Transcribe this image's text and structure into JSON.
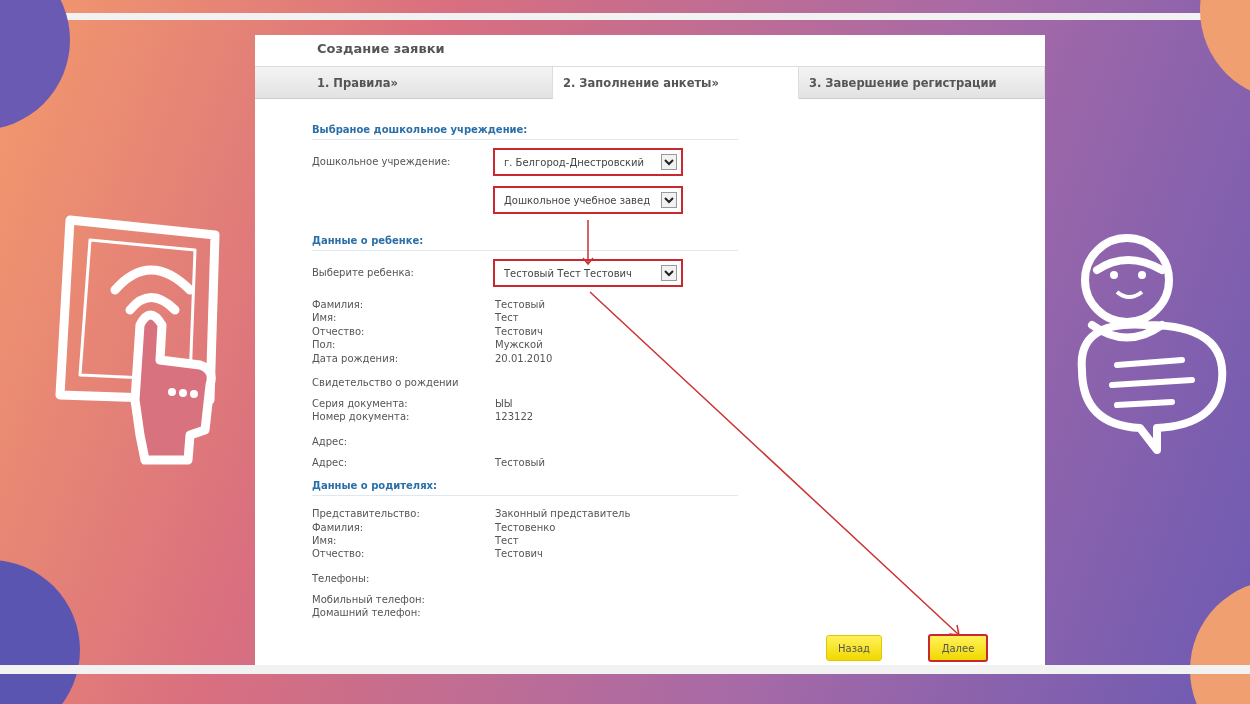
{
  "title": "Создание заявки",
  "tabs": [
    {
      "label": "1. Правила»",
      "selected": false
    },
    {
      "label": "2. Заполнение анкеты»",
      "selected": true
    },
    {
      "label": "3. Завершение регистрации",
      "selected": false
    }
  ],
  "institution": {
    "heading": "Выбраное дошкольное учреждение:",
    "label": "Дошкольное учреждение:",
    "selects": [
      {
        "value": "г. Белгород-Днестровский",
        "highlighted": true
      },
      {
        "value": "Дошкольное учебное завед",
        "highlighted": true
      }
    ]
  },
  "child": {
    "heading": "Данные о ребенке:",
    "select_label": "Выберите ребенка:",
    "select": {
      "value": "Тестовый Тест Тестович",
      "highlighted": true
    },
    "groups": [
      {
        "rows": [
          {
            "label": "Фамилия:",
            "value": "Тестовый"
          },
          {
            "label": "Имя:",
            "value": "Тест"
          },
          {
            "label": "Отчество:",
            "value": "Тестович"
          },
          {
            "label": "Пол:",
            "value": "Мужской"
          },
          {
            "label": "Дата рождения:",
            "value": "20.01.2010"
          }
        ]
      },
      {
        "title": "Свидетельство о рождении",
        "rows": [
          {
            "label": "Серия документа:",
            "value": "ЫЫ"
          },
          {
            "label": "Номер документа:",
            "value": "123122"
          }
        ]
      },
      {
        "title": "Адрес:",
        "rows": [
          {
            "label": "Адрес:",
            "value": "Тестовый"
          }
        ]
      }
    ]
  },
  "parents": {
    "heading": "Данные о родителях:",
    "groups": [
      {
        "rows": [
          {
            "label": "Представительство:",
            "value": "Законный представитель"
          },
          {
            "label": "Фамилия:",
            "value": "Тестовенко"
          },
          {
            "label": "Имя:",
            "value": "Тест"
          },
          {
            "label": "Отчество:",
            "value": "Тестович"
          }
        ]
      },
      {
        "title": "Телефоны:",
        "rows": [
          {
            "label": "Мобильный телефон:"
          },
          {
            "label": "Домашний телефон:"
          }
        ]
      }
    ]
  },
  "buttons": [
    {
      "label": "Назад",
      "highlighted": false
    },
    {
      "label": "Далее",
      "highlighted": true
    }
  ]
}
